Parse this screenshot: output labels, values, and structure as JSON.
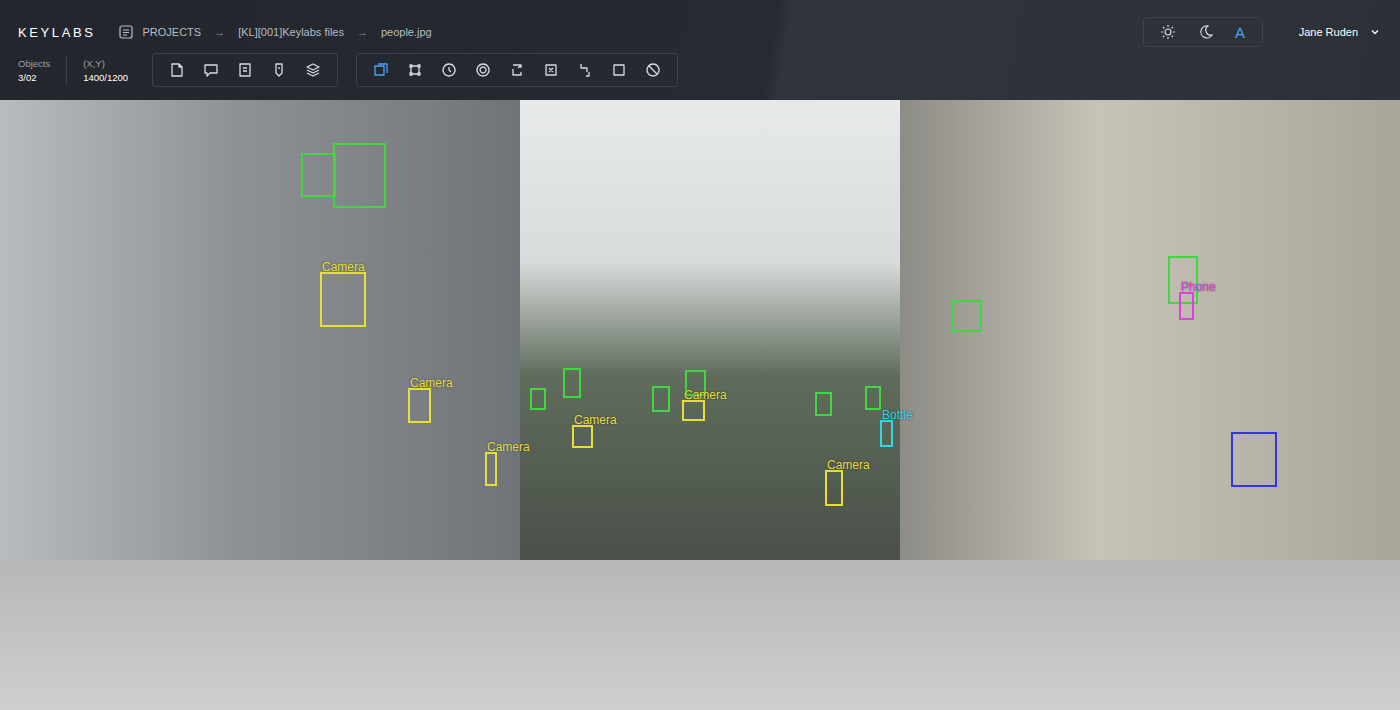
{
  "app": {
    "logo": "KEYLABS"
  },
  "breadcrumbs": [
    {
      "label": "PROJECTS"
    },
    {
      "label": "[KL][001]Keylabs files"
    },
    {
      "label": "people.jpg"
    }
  ],
  "breadcrumb_separator": "→",
  "stats": [
    {
      "label": "Objects",
      "value": "3/02"
    },
    {
      "label": "(X,Y)",
      "value": "1400/1200"
    }
  ],
  "toolbar_groups": [
    {
      "tools": [
        {
          "selected": false
        },
        {
          "selected": false
        },
        {
          "selected": false
        },
        {
          "selected": false
        },
        {
          "selected": false
        }
      ]
    },
    {
      "tools": [
        {
          "selected": true
        },
        {
          "selected": false
        },
        {
          "selected": false
        },
        {
          "selected": false
        },
        {
          "selected": false
        },
        {
          "selected": false
        },
        {
          "selected": false
        },
        {
          "selected": false
        },
        {
          "selected": false
        }
      ]
    }
  ],
  "theme_modes": [
    {
      "kind": "light",
      "selected": false
    },
    {
      "kind": "dark",
      "selected": false
    },
    {
      "kind": "auto",
      "label": "A",
      "selected": true
    }
  ],
  "user": {
    "name": "Jane Ruden"
  },
  "annotations": [
    {
      "color": "#3fd83f"
    },
    {
      "color": "#3fd83f"
    },
    {
      "color": "#3fd83f"
    },
    {
      "color": "#3fd83f"
    },
    {
      "color": "#3fd83f"
    },
    {
      "color": "#3fd83f"
    },
    {
      "color": "#3fd83f"
    },
    {
      "color": "#3fd83f"
    },
    {
      "color": "#3fd83f"
    },
    {
      "color": "#3fd83f"
    },
    {
      "label": "Camera",
      "color": "#e6df3a"
    },
    {
      "label": "Camera",
      "color": "#e6df3a"
    },
    {
      "label": "Camera",
      "color": "#e6df3a"
    },
    {
      "label": "Camera",
      "color": "#e6df3a"
    },
    {
      "label": "Camera",
      "color": "#e6df3a"
    },
    {
      "label": "Camera",
      "color": "#e6df3a"
    },
    {
      "label": "Bottle",
      "color": "#33d6e6"
    },
    {
      "label": "Phone",
      "color": "#e040e0"
    },
    {
      "color": "#3434e0"
    }
  ]
}
